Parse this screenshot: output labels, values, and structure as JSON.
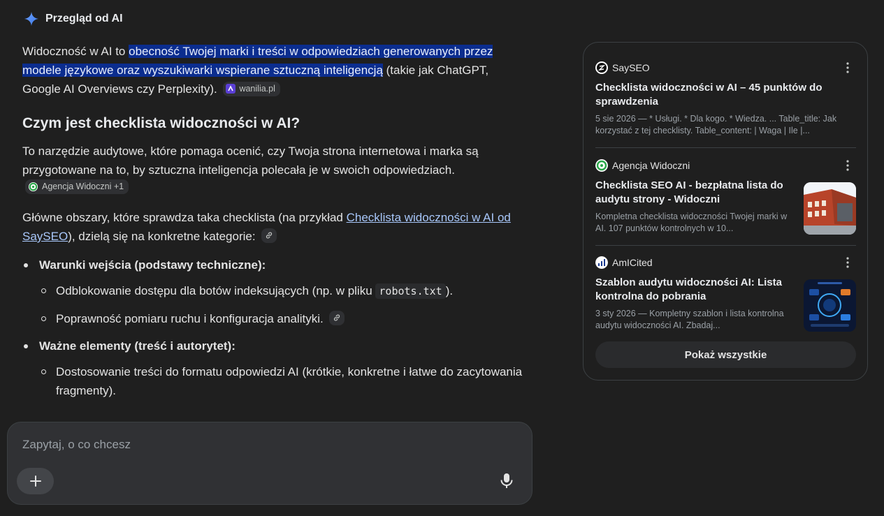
{
  "header": {
    "title": "Przegląd od AI",
    "icon": "gemini-sparkle-icon"
  },
  "intro": {
    "before": "Widoczność w AI to ",
    "highlight": "obecność Twojej marki i treści w odpowiedziach generowanych przez modele językowe oraz wyszukiwarki wspierane sztuczną inteligencją",
    "after": " (takie jak ChatGPT, Google AI Overviews czy Perplexity).",
    "chip": "wanilia.pl"
  },
  "section_heading": "Czym jest checklista widoczności w AI?",
  "para1": {
    "text": "To narzędzie audytowe, które pomaga ocenić, czy Twoja strona internetowa i marka są przygotowane na to, by sztuczna inteligencja polecała je w swoich odpowiedziach.",
    "chip": "Agencja Widoczni +1"
  },
  "para2": {
    "before": "Główne obszary, które sprawdza taka checklista (na przykład ",
    "link": "Checklista widoczności w AI od SaySEO",
    "after": "), dzielą się na konkretne kategorie:"
  },
  "list": {
    "cat1": {
      "title": "Warunki wejścia (podstawy techniczne):",
      "item1_before": "Odblokowanie dostępu dla botów indeksujących (np. w pliku ",
      "item1_code": "robots.txt",
      "item1_after": ").",
      "item2": "Poprawność pomiaru ruchu i konfiguracja analityki."
    },
    "cat2": {
      "title": "Ważne elementy (treść i autorytet):",
      "item1": "Dostosowanie treści do formatu odpowiedzi AI (krótkie, konkretne i łatwe do zacytowania fragmenty)."
    }
  },
  "ask": {
    "placeholder": "Zapytaj, o co chcesz"
  },
  "sources": [
    {
      "site": "SaySEO",
      "title": "Checklista widoczności w AI – 45 punktów do sprawdzenia",
      "snippet": "5 sie 2026 — * Usługi. * Dla kogo. * Wiedza. ... Table_title: Jak korzystać z tej checklisty. Table_content: | Waga | Ile |..."
    },
    {
      "site": "Agencja Widoczni",
      "title": "Checklista SEO AI - bezpłatna lista do audytu strony - Widoczni",
      "snippet": "Kompletna checklista widoczności Twojej marki w AI. 107 punktów kontrolnych w 10..."
    },
    {
      "site": "AmICited",
      "title": "Szablon audytu widoczności AI: Lista kontrolna do pobrania",
      "snippet": "3 sty 2026 — Kompletny szablon i lista kontrolna audytu widoczności AI. Zbadaj..."
    }
  ],
  "show_all": "Pokaż wszystkie",
  "colors": {
    "highlight": "#0b2d8f",
    "link": "#a8c7fa",
    "background": "#1f1f1f"
  }
}
